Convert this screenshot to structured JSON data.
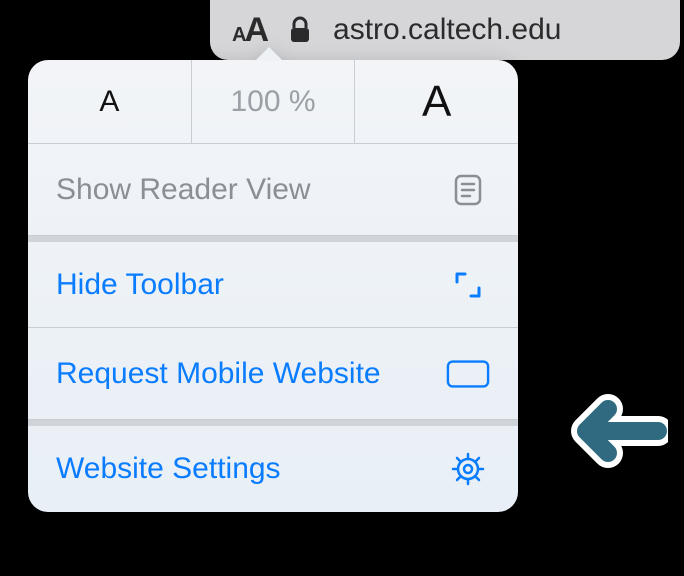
{
  "addressbar": {
    "url": "astro.caltech.edu"
  },
  "popover": {
    "zoom_value": "100 %",
    "reader_label": "Show Reader View",
    "hide_toolbar_label": "Hide Toolbar",
    "request_mobile_label": "Request Mobile Website",
    "website_settings_label": "Website Settings"
  }
}
